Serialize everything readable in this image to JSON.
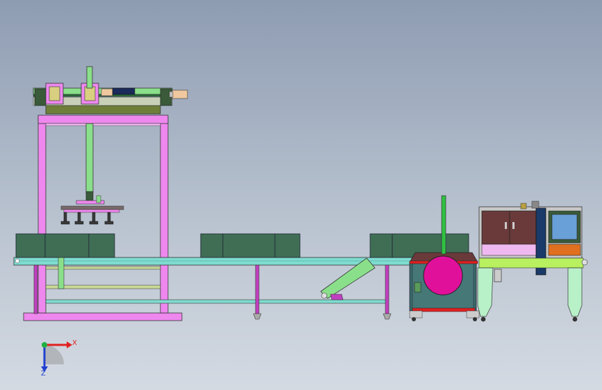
{
  "view": {
    "background_top": "#8e9cb2",
    "background_bottom": "#d4dae2"
  },
  "axis_triad": {
    "x_label": "X",
    "z_label": "Z",
    "x_color": "#e02020",
    "z_color": "#2040d0",
    "y_color": "#20b040"
  },
  "machine": {
    "frame_color": "#ee88ee",
    "conveyor_color": "#7fdcd0",
    "carton_color": "#3f6e55",
    "gantry_color": "#8ae08a",
    "rotary_color": "#e0109a",
    "cabinet_color": "#6a3a3a",
    "screen_color": "#6aa0d8"
  }
}
